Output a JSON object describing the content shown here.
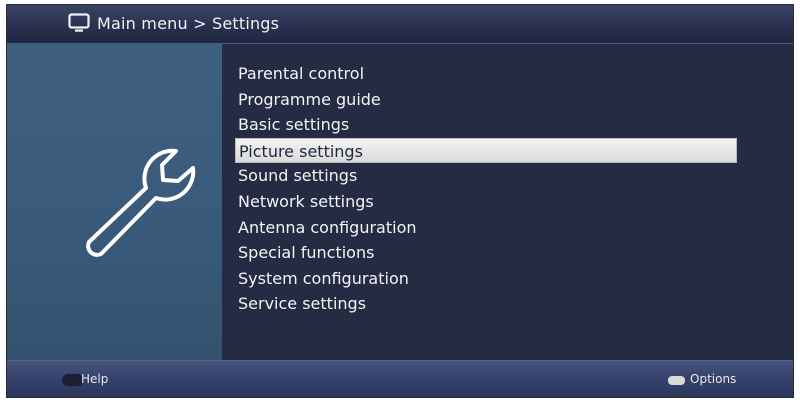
{
  "header": {
    "icon": "tv-icon",
    "breadcrumb": "Main menu > Settings"
  },
  "side_panel": {
    "icon": "wrench-icon"
  },
  "menu": {
    "items": [
      {
        "label": "Parental control"
      },
      {
        "label": "Programme guide"
      },
      {
        "label": "Basic settings"
      },
      {
        "label": "Picture settings",
        "selected": true
      },
      {
        "label": "Sound settings"
      },
      {
        "label": "Network settings"
      },
      {
        "label": "Antenna configuration"
      },
      {
        "label": "Special functions"
      },
      {
        "label": "System configuration"
      },
      {
        "label": "Service settings"
      }
    ]
  },
  "footer": {
    "help_label": "Help",
    "help_button_color": "#1b2036",
    "options_label": "Options",
    "options_button_color": "#d9d9d9"
  },
  "colors": {
    "background": "#242b43",
    "side_panel": "#3a5b7c",
    "highlight": "#e8e8e8",
    "text": "#f4f4f4"
  }
}
